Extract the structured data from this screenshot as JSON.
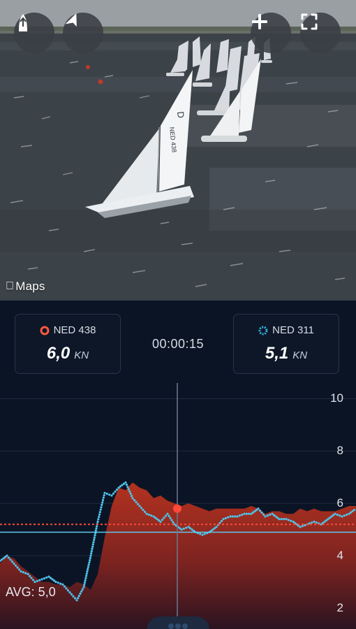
{
  "video": {
    "attribution": "Maps",
    "buttons": [
      {
        "name": "boat-heading-button",
        "icon": "boat-icon"
      },
      {
        "name": "navigate-button",
        "icon": "navigation-arrow-icon"
      },
      {
        "name": "zoom-in-button",
        "icon": "plus-icon"
      },
      {
        "name": "fullscreen-button",
        "icon": "fullscreen-icon"
      }
    ]
  },
  "stats": {
    "left": {
      "boat": "NED 438",
      "speed": "6,0",
      "unit": "KN",
      "color": "#ff5a3c"
    },
    "right": {
      "boat": "NED 311",
      "speed": "5,1",
      "unit": "KN",
      "color": "#38b6e6"
    },
    "timer": "00:00:15"
  },
  "chart_data": {
    "type": "area",
    "ylim": [
      1.2,
      10.6
    ],
    "yticks": [
      {
        "value": 10,
        "label": "10"
      },
      {
        "value": 8,
        "label": "8"
      },
      {
        "value": 6,
        "label": "6"
      },
      {
        "value": 4,
        "label": "4"
      },
      {
        "value": 2,
        "label": "2"
      }
    ],
    "avg_label": "AVG: 5,0",
    "avg_ned438": 5.2,
    "avg_ned311": 4.9,
    "cursor_value": 5.8,
    "series": [
      {
        "name": "NED 438",
        "color": "#b8321f",
        "style": "area",
        "values": [
          3.7,
          4.0,
          3.9,
          3.6,
          3.4,
          3.2,
          3.0,
          3.0,
          2.9,
          2.9,
          2.8,
          3.0,
          2.9,
          2.7,
          3.3,
          4.7,
          5.9,
          6.6,
          6.5,
          6.8,
          6.6,
          6.5,
          6.2,
          6.3,
          6.1,
          6.0,
          5.9,
          6.0,
          5.9,
          5.8,
          5.7,
          5.8,
          5.8,
          5.8,
          5.8,
          5.8,
          5.9,
          5.8,
          5.6,
          5.7,
          5.7,
          5.6,
          5.6,
          5.8,
          5.7,
          5.8,
          5.7,
          5.7,
          5.7,
          5.8,
          5.9,
          5.9
        ]
      },
      {
        "name": "NED 311",
        "color": "#4fc3ea",
        "style": "dotted-line",
        "values": [
          3.8,
          4.0,
          3.7,
          3.4,
          3.3,
          3.0,
          3.1,
          3.2,
          3.0,
          2.9,
          2.6,
          2.3,
          2.8,
          4.0,
          5.3,
          6.4,
          6.3,
          6.6,
          6.8,
          6.2,
          5.9,
          5.6,
          5.5,
          5.3,
          5.6,
          5.2,
          5.0,
          5.1,
          4.9,
          4.8,
          4.9,
          5.1,
          5.4,
          5.5,
          5.5,
          5.6,
          5.6,
          5.8,
          5.5,
          5.6,
          5.4,
          5.4,
          5.3,
          5.1,
          5.2,
          5.3,
          5.2,
          5.4,
          5.6,
          5.5,
          5.6,
          5.8
        ]
      }
    ]
  }
}
